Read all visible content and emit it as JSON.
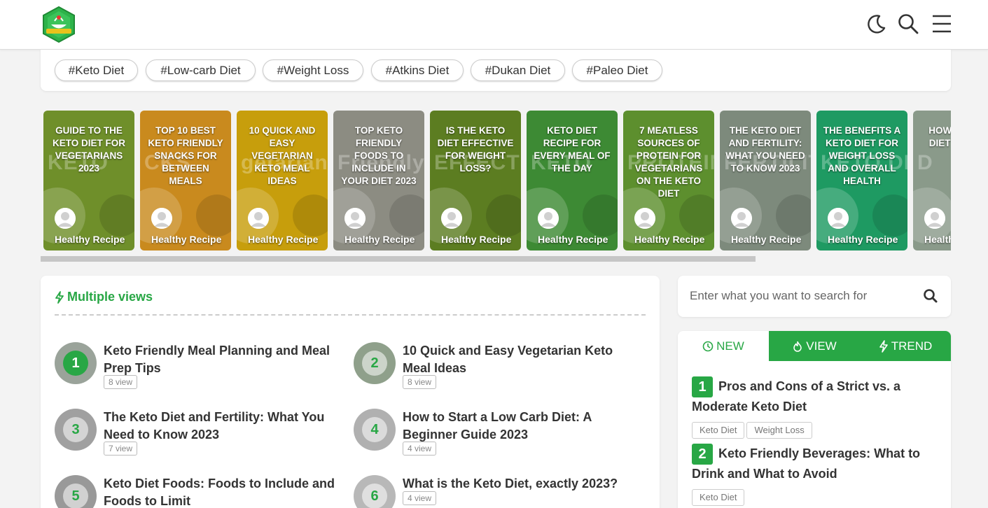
{
  "header": {
    "logo_icon": "site-logo-icon",
    "icons": [
      "moon-icon",
      "search-icon",
      "menu-icon"
    ]
  },
  "tags": [
    "#Keto Diet",
    "#Low-carb Diet",
    "#Weight Loss",
    "#Atkins Diet",
    "#Dukan Diet",
    "#Paleo Diet"
  ],
  "carousel": {
    "slides": [
      {
        "title": "GUIDE TO THE KETO DIET FOR VEGETARIANS 2023",
        "author": "Healthy Recipe",
        "color": "#6f8f2a",
        "bg_word": "KETO"
      },
      {
        "title": "TOP 10 BEST KETO FRIENDLY SNACKS FOR BETWEEN MEALS",
        "author": "Healthy Recipe",
        "color": "#c98a1e",
        "bg_word": "CKS"
      },
      {
        "title": "10 QUICK AND EASY VEGETARIAN KETO MEAL IDEAS",
        "author": "Healthy Recipe",
        "color": "#c79e0c",
        "bg_word": "getarian Ke"
      },
      {
        "title": "TOP KETO FRIENDLY FOODS TO INCLUDE IN YOUR DIET 2023",
        "author": "Healthy Recipe",
        "color": "#8c8c82",
        "bg_word": "Friendly"
      },
      {
        "title": "IS THE KETO DIET EFFECTIVE FOR WEIGHT LOSS?",
        "author": "Healthy Recipe",
        "color": "#5c7d21",
        "bg_word": "EFFECTIVE"
      },
      {
        "title": "KETO DIET RECIPE FOR EVERY MEAL OF THE DAY",
        "author": "Healthy Recipe",
        "color": "#3d8a34",
        "bg_word": "KETO"
      },
      {
        "title": "7 MEATLESS SOURCES OF PROTEIN FOR VEGETARIANS ON THE KETO DIET",
        "author": "Healthy Recipe",
        "color": "#5d8f2e",
        "bg_word": "PROTEIN"
      },
      {
        "title": "THE KETO DIET AND FERTILITY: WHAT YOU NEED TO KNOW 2023",
        "author": "Healthy Recipe",
        "color": "#7d8a7c",
        "bg_word": "FERTILITY"
      },
      {
        "title": "THE BENEFITS A KETO DIET FOR WEIGHT LOSS AND OVERALL HEALTH",
        "author": "Healthy Recipe",
        "color": "#1e9a62",
        "bg_word": "KETO DIET F"
      },
      {
        "title": "HOW TO TRY DIET EATING",
        "author": "Healthy Recipe",
        "color": "#8a9a8a",
        "bg_word": "D"
      }
    ],
    "scroll_fraction": 0.785
  },
  "multiple_views": {
    "title": "Multiple views",
    "posts": [
      {
        "rank": "1",
        "title": "Keto Friendly Meal Planning and Meal Prep Tips",
        "views": "8 view"
      },
      {
        "rank": "2",
        "title": "10 Quick and Easy Vegetarian Keto Meal Ideas",
        "views": "8 view"
      },
      {
        "rank": "3",
        "title": "The Keto Diet and Fertility: What You Need to Know 2023",
        "views": "7 view"
      },
      {
        "rank": "4",
        "title": "How to Start a Low Carb Diet: A Beginner Guide 2023",
        "views": "4 view"
      },
      {
        "rank": "5",
        "title": "Keto Diet Foods: Foods to Include and Foods to Limit",
        "views": ""
      },
      {
        "rank": "6",
        "title": "What is the Keto Diet, exactly 2023?",
        "views": "4 view"
      }
    ]
  },
  "search": {
    "placeholder": "Enter what you want to search for"
  },
  "sidebar": {
    "tabs": [
      {
        "label": "NEW",
        "icon": "clock-icon"
      },
      {
        "label": "VIEW",
        "icon": "fire-icon"
      },
      {
        "label": "TREND",
        "icon": "bolt-icon"
      }
    ],
    "items": [
      {
        "rank": "1",
        "title": "Pros and Cons of a Strict vs. a Moderate Keto Diet",
        "tags": [
          "Keto Diet",
          "Weight Loss"
        ]
      },
      {
        "rank": "2",
        "title": "Keto Friendly Beverages: What to Drink and What to Avoid",
        "tags": [
          "Keto Diet"
        ]
      }
    ]
  },
  "colors": {
    "accent": "#28a745",
    "background": "#f3f3f3"
  }
}
